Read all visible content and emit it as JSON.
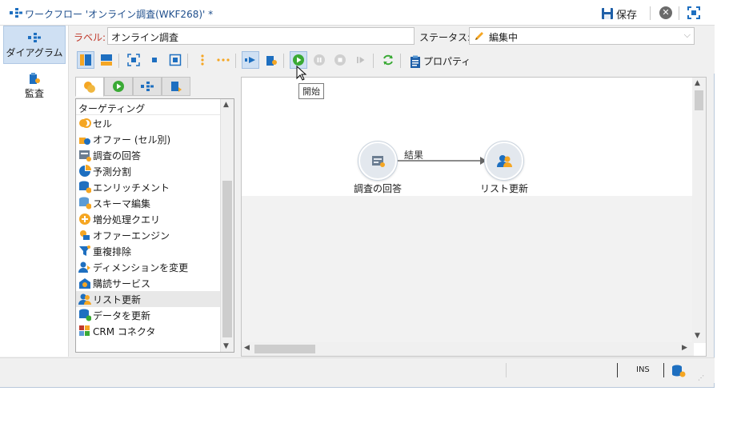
{
  "window": {
    "title": "ワークフロー 'オンライン調査(WKF268)' *",
    "save_label": "保存"
  },
  "sidenav": {
    "items": [
      {
        "label": "ダイアグラム"
      },
      {
        "label": "監査"
      }
    ]
  },
  "form": {
    "label_caption": "ラベル:",
    "label_value": "オンライン調査",
    "status_caption": "ステータス:",
    "status_value": "編集中"
  },
  "toolbar": {
    "properties_label": "プロパティ",
    "tooltip": "開始"
  },
  "palette": {
    "category": "ターゲティング",
    "items": [
      {
        "label": "セル",
        "icon": "cell-icon"
      },
      {
        "label": "オファー (セル別)",
        "icon": "offer-by-cell-icon"
      },
      {
        "label": "調査の回答",
        "icon": "survey-answers-icon"
      },
      {
        "label": "予測分割",
        "icon": "predictive-split-icon"
      },
      {
        "label": "エンリッチメント",
        "icon": "enrichment-icon"
      },
      {
        "label": "スキーマ編集",
        "icon": "schema-edit-icon"
      },
      {
        "label": "増分処理クエリ",
        "icon": "incremental-query-icon"
      },
      {
        "label": "オファーエンジン",
        "icon": "offer-engine-icon"
      },
      {
        "label": "重複排除",
        "icon": "deduplication-icon"
      },
      {
        "label": "ディメンションを変更",
        "icon": "change-dimension-icon"
      },
      {
        "label": "購読サービス",
        "icon": "subscription-services-icon"
      },
      {
        "label": "リスト更新",
        "icon": "list-update-icon",
        "selected": true
      },
      {
        "label": "データを更新",
        "icon": "update-data-icon"
      },
      {
        "label": "CRM コネクタ",
        "icon": "crm-connector-icon"
      }
    ]
  },
  "diagram": {
    "nodes": [
      {
        "label": "調査の回答",
        "icon": "survey-answers-icon"
      },
      {
        "label": "リスト更新",
        "icon": "list-update-icon"
      }
    ],
    "transition_label": "結果"
  },
  "statusbar": {
    "ins": "INS"
  },
  "colors": {
    "accent": "#1e6fc0",
    "orange": "#f5a623",
    "green": "#3aaa35",
    "title_blue": "#1e4e8c",
    "label_red": "#c0392b"
  }
}
